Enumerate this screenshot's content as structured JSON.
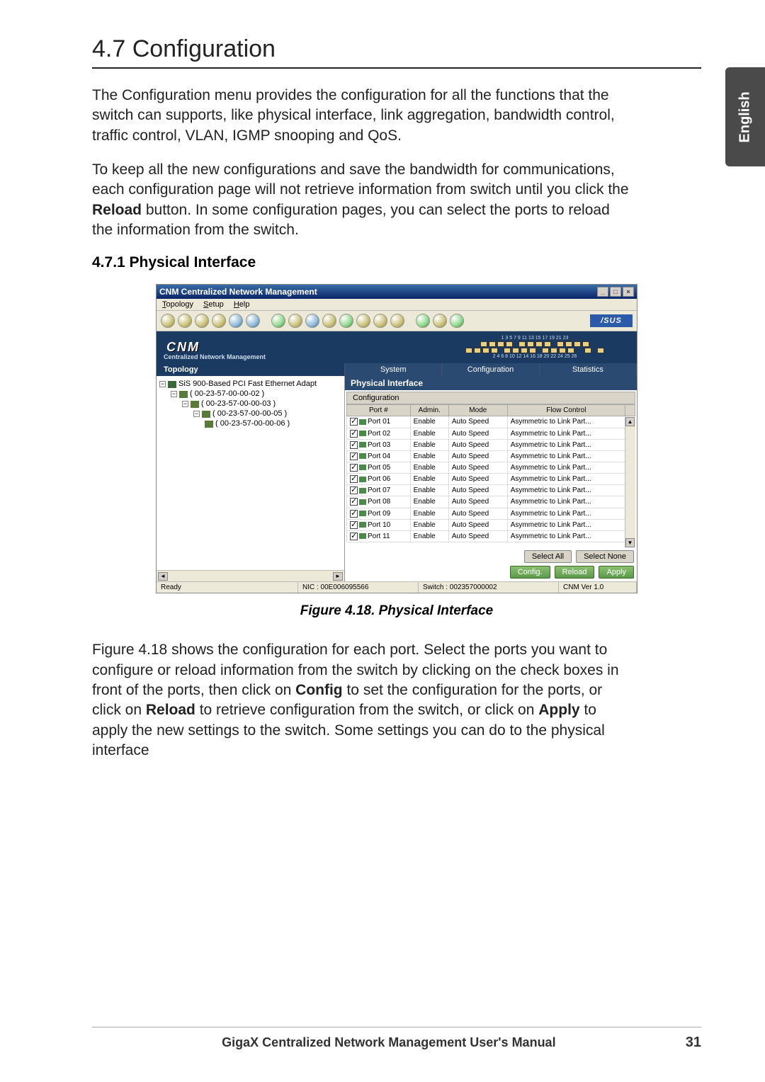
{
  "sideTab": "English",
  "heading": "4.7   Configuration",
  "para1": "The Configuration menu provides the configuration for all the functions that the switch can supports, like physical interface, link aggregation, bandwidth control, traffic control, VLAN, IGMP snooping and QoS.",
  "para2_a": "To keep all the new configurations and save the bandwidth for communications, each configuration page will not retrieve information from switch until you click the ",
  "para2_bold": "Reload",
  "para2_b": " button. In some configuration pages, you can select the ports to reload the information from the switch.",
  "subhead": "4.7.1   Physical Interface",
  "app": {
    "title": "CNM Centralized Network Management",
    "menu": {
      "m1": "Topology",
      "m2": "Setup",
      "m3": "Help"
    },
    "brandLogo": "/SUS",
    "bannerLogo": "CNM",
    "bannerSub": "Centralized Network Management",
    "portTop": "1  3  5  7   9 11 13 15  17 19 21 23",
    "portBot": "2  4  6  8  10 12 14 16  18 20 22 24   25    26",
    "tabs": {
      "topology": "Topology",
      "system": "System",
      "config": "Configuration",
      "stats": "Statistics"
    },
    "tree": {
      "root": "SiS 900-Based PCI Fast Ethernet Adapt",
      "n1": "( 00-23-57-00-00-02 )",
      "n2": "( 00-23-57-00-00-03 )",
      "n3": "( 00-23-57-00-00-05 )",
      "n4": "( 00-23-57-00-00-06 )"
    },
    "sectionTitle": "Physical Interface",
    "gridLabel": "Configuration",
    "cols": {
      "c1": "Port #",
      "c2": "Admin.",
      "c3": "Mode",
      "c4": "Flow Control"
    },
    "rows": [
      {
        "port": "Port 01",
        "admin": "Enable",
        "mode": "Auto Speed",
        "flow": "Asymmetric to Link Part..."
      },
      {
        "port": "Port 02",
        "admin": "Enable",
        "mode": "Auto Speed",
        "flow": "Asymmetric to Link Part..."
      },
      {
        "port": "Port 03",
        "admin": "Enable",
        "mode": "Auto Speed",
        "flow": "Asymmetric to Link Part..."
      },
      {
        "port": "Port 04",
        "admin": "Enable",
        "mode": "Auto Speed",
        "flow": "Asymmetric to Link Part..."
      },
      {
        "port": "Port 05",
        "admin": "Enable",
        "mode": "Auto Speed",
        "flow": "Asymmetric to Link Part..."
      },
      {
        "port": "Port 06",
        "admin": "Enable",
        "mode": "Auto Speed",
        "flow": "Asymmetric to Link Part..."
      },
      {
        "port": "Port 07",
        "admin": "Enable",
        "mode": "Auto Speed",
        "flow": "Asymmetric to Link Part..."
      },
      {
        "port": "Port 08",
        "admin": "Enable",
        "mode": "Auto Speed",
        "flow": "Asymmetric to Link Part..."
      },
      {
        "port": "Port 09",
        "admin": "Enable",
        "mode": "Auto Speed",
        "flow": "Asymmetric to Link Part..."
      },
      {
        "port": "Port 10",
        "admin": "Enable",
        "mode": "Auto Speed",
        "flow": "Asymmetric to Link Part..."
      },
      {
        "port": "Port 11",
        "admin": "Enable",
        "mode": "Auto Speed",
        "flow": "Asymmetric to Link Part..."
      }
    ],
    "buttons": {
      "selAll": "Select All",
      "selNone": "Select None",
      "config": "Config.",
      "reload": "Reload",
      "apply": "Apply"
    },
    "status": {
      "ready": "Ready",
      "nic": "NIC : 00E006095566",
      "switch": "Switch : 002357000002",
      "ver": "CNM Ver 1.0"
    }
  },
  "figcap": "Figure 4.18. Physical Interface",
  "para3_a": "Figure 4.18 shows the configuration for each port. Select the ports you want to configure or reload information from the switch by clicking on the check boxes in front of the ports, then click on ",
  "para3_b1": "Config",
  "para3_b": " to set the configuration for the ports, or click on ",
  "para3_b2": "Reload",
  "para3_c": " to retrieve configuration from the switch, or click on ",
  "para3_b3": "Apply",
  "para3_d": " to apply the new settings to the switch. Some settings you can do to the physical interface",
  "footer": {
    "title": "GigaX Centralized Network Management User's Manual",
    "page": "31"
  }
}
